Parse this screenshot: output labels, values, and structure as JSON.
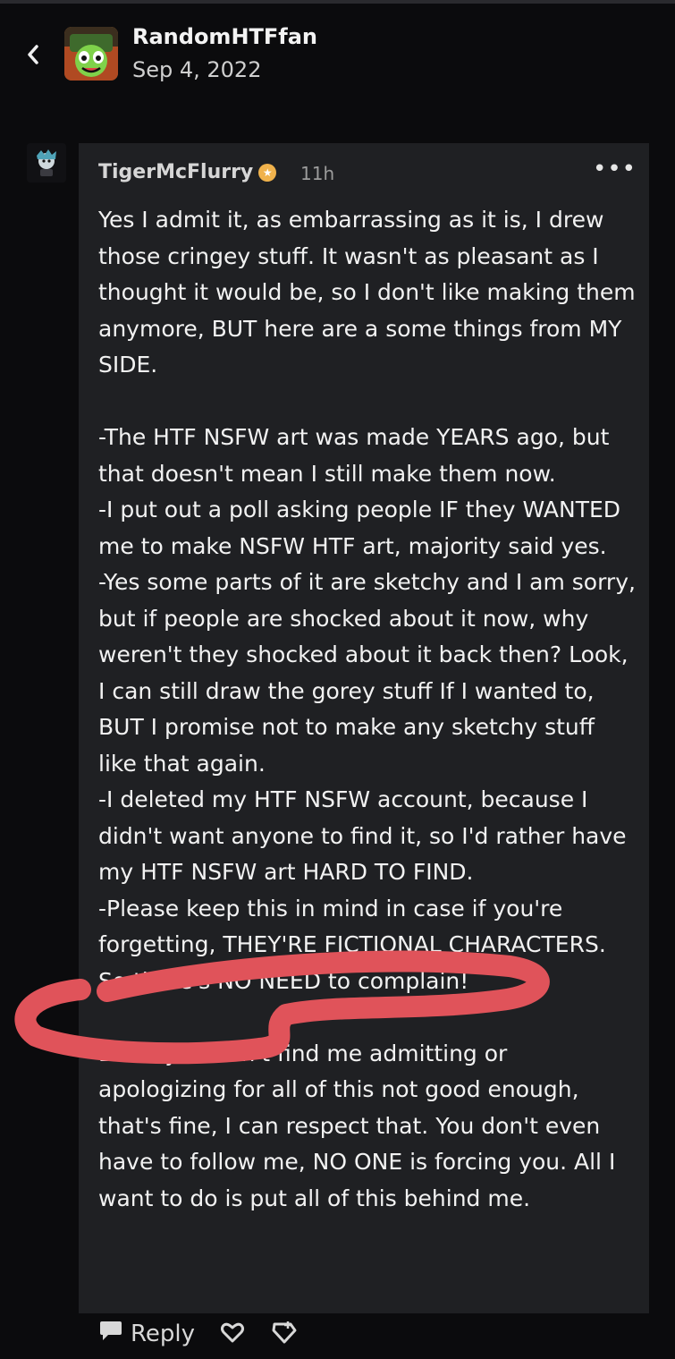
{
  "header": {
    "username": "RandomHTFfan",
    "date": "Sep 4, 2022",
    "back_icon": "back-chevron-icon"
  },
  "comment": {
    "username": "TigerMcFlurry",
    "badge_icon": "gold-badge-icon",
    "time": "11h",
    "more_label": "•••",
    "paragraphs": {
      "p1": "Yes I admit it, as embarrassing as it is, I drew those cringey stuff. It wasn't as pleasant as I thought it would be, so I don't like making them anymore, BUT here are a some things from MY SIDE.",
      "p2": "-The HTF NSFW art was made YEARS ago, but that doesn't mean I still make them now.",
      "p3": "-I put out a poll asking people IF they WANTED me to make NSFW HTF art, majority said yes.",
      "p4": "-Yes some parts of it are sketchy and I am sorry, but if people are shocked about it now, why weren't they shocked about it back then? Look, I can still draw the gorey stuff If I wanted to, BUT I promise not to make any sketchy stuff like that again.",
      "p5": "-I deleted my HTF NSFW account, because I didn't want anyone to find it, so I'd rather have  my HTF NSFW art HARD TO FIND.",
      "p6": "-Please keep this in mind in case if you're forgetting, THEY'RE FICTIONAL CHARACTERS. So there's NO NEED to complain!",
      "p7": "But if you don't find me admitting or apologizing for all of this not good enough, that's fine, I can respect that. You don't even have to follow me, NO ONE is forcing you. All I want to do is put all of this behind me."
    }
  },
  "actions": {
    "reply_label": "Reply",
    "like_icon": "heart-icon",
    "tip_icon": "tip-props-icon"
  },
  "colors": {
    "background": "#0b0b0d",
    "card": "#1f2023",
    "highlight_scribble": "#e0535a",
    "badge": "#f0b24c"
  }
}
